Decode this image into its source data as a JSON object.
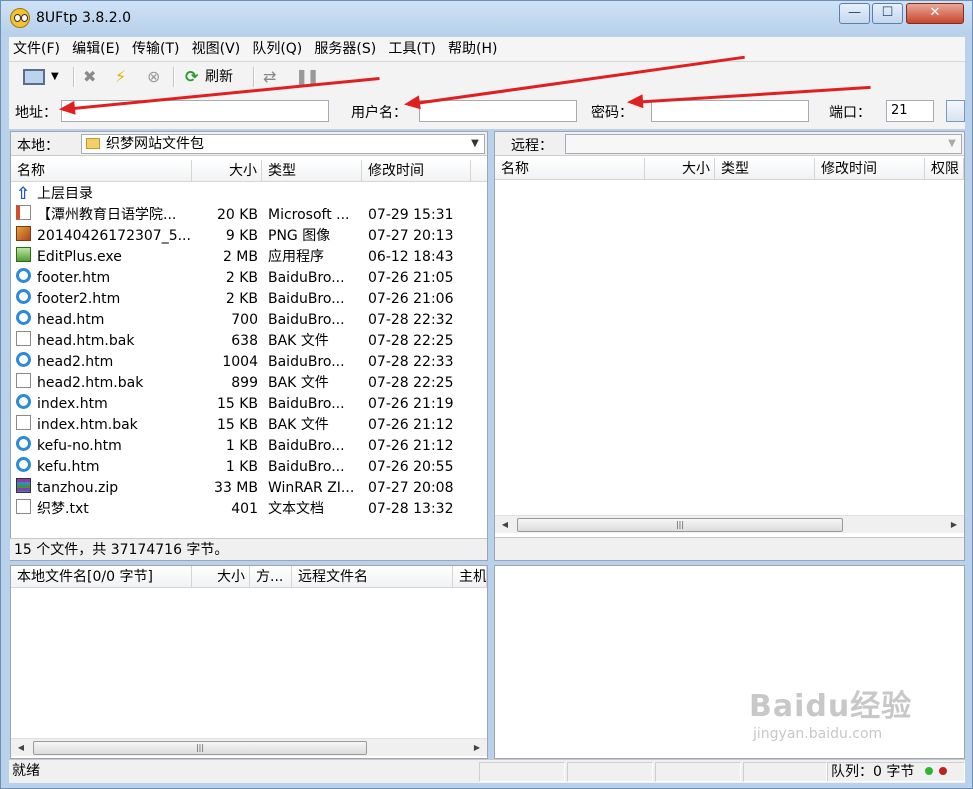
{
  "app": {
    "title": "8UFtp 3.8.2.0"
  },
  "window_buttons": {
    "minimize": "—",
    "maximize": "☐",
    "close": "✕"
  },
  "menu": [
    "文件(F)",
    "编辑(E)",
    "传输(T)",
    "视图(V)",
    "队列(Q)",
    "服务器(S)",
    "工具(T)",
    "帮助(H)"
  ],
  "toolbar": {
    "refresh_label": "刷新"
  },
  "connection": {
    "address_label": "地址：",
    "address_value": "",
    "user_label": "用户名：",
    "user_value": "",
    "password_label": "密码：",
    "password_value": "",
    "port_label": "端口：",
    "port_value": "21"
  },
  "local": {
    "label": "本地：",
    "path": "织梦网站文件包",
    "columns": [
      "名称",
      "大小",
      "类型",
      "修改时间"
    ],
    "files": [
      {
        "name": "上层目录",
        "size": "",
        "type": "",
        "modified": "",
        "icon": "up-dir-icon"
      },
      {
        "name": "【潭州教育日语学院...",
        "size": "20 KB",
        "type": "Microsoft ...",
        "modified": "07-29 15:31",
        "icon": "word-doc-icon"
      },
      {
        "name": "20140426172307_5...",
        "size": "9 KB",
        "type": "PNG 图像",
        "modified": "07-27 20:13",
        "icon": "png-image-icon"
      },
      {
        "name": "EditPlus.exe",
        "size": "2 MB",
        "type": "应用程序",
        "modified": "06-12 18:43",
        "icon": "exe-icon"
      },
      {
        "name": "footer.htm",
        "size": "2 KB",
        "type": "BaiduBro...",
        "modified": "07-26 21:05",
        "icon": "htm-icon"
      },
      {
        "name": "footer2.htm",
        "size": "2 KB",
        "type": "BaiduBro...",
        "modified": "07-26 21:06",
        "icon": "htm-icon"
      },
      {
        "name": "head.htm",
        "size": "700",
        "type": "BaiduBro...",
        "modified": "07-28 22:32",
        "icon": "htm-icon"
      },
      {
        "name": "head.htm.bak",
        "size": "638",
        "type": "BAK 文件",
        "modified": "07-28 22:25",
        "icon": "blank-file-icon"
      },
      {
        "name": "head2.htm",
        "size": "1004",
        "type": "BaiduBro...",
        "modified": "07-28 22:33",
        "icon": "htm-icon"
      },
      {
        "name": "head2.htm.bak",
        "size": "899",
        "type": "BAK 文件",
        "modified": "07-28 22:25",
        "icon": "blank-file-icon"
      },
      {
        "name": "index.htm",
        "size": "15 KB",
        "type": "BaiduBro...",
        "modified": "07-26 21:19",
        "icon": "htm-icon"
      },
      {
        "name": "index.htm.bak",
        "size": "15 KB",
        "type": "BAK 文件",
        "modified": "07-26 21:12",
        "icon": "blank-file-icon"
      },
      {
        "name": "kefu-no.htm",
        "size": "1 KB",
        "type": "BaiduBro...",
        "modified": "07-26 21:12",
        "icon": "htm-icon"
      },
      {
        "name": "kefu.htm",
        "size": "1 KB",
        "type": "BaiduBro...",
        "modified": "07-26 20:55",
        "icon": "htm-icon"
      },
      {
        "name": "tanzhou.zip",
        "size": "33 MB",
        "type": "WinRAR ZI...",
        "modified": "07-27 20:08",
        "icon": "zip-archive-icon"
      },
      {
        "name": "织梦.txt",
        "size": "401",
        "type": "文本文档",
        "modified": "07-28 13:32",
        "icon": "text-file-icon"
      }
    ],
    "summary": "15 个文件，共 37174716 字节。"
  },
  "remote": {
    "label": "远程：",
    "path": "",
    "columns": [
      "名称",
      "大小",
      "类型",
      "修改时间",
      "权限"
    ]
  },
  "queue": {
    "columns": [
      "本地文件名[0/0 字节]",
      "大小",
      "方...",
      "远程文件名",
      "主机"
    ]
  },
  "status": {
    "text": "就绪",
    "queue": "队列：0 字节"
  },
  "watermark": {
    "brand": "Baidu经验",
    "url": "jingyan.baidu.com"
  },
  "colors": {
    "annotation_arrow": "#e02020",
    "window_frame": "#b9d1ea"
  }
}
